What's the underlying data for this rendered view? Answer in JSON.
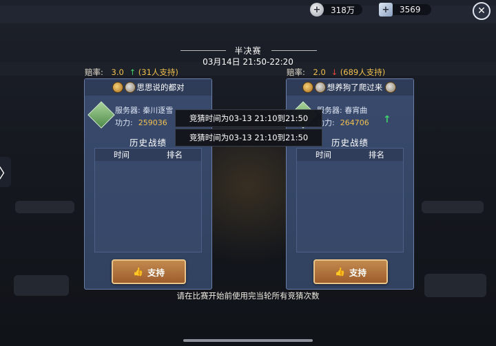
{
  "top_bar": {
    "silver": {
      "icon": "silver-coin-plus-icon",
      "value": "318万"
    },
    "ticket": {
      "icon": "ticket-plus-icon",
      "value": "3569"
    },
    "close": {
      "icon": "close-icon",
      "label": "✕"
    }
  },
  "side_toggle": {
    "icon": "chevron-right-icon",
    "label": "〉"
  },
  "match": {
    "stage": "半决赛",
    "time": "03月14日 21:50-22:20"
  },
  "left": {
    "odds_label": "赔率:",
    "odds_value": "3.0",
    "trend": "↑",
    "supporters": "(31人支持)",
    "player_name": "思思说的都对",
    "server_label": "服务器: 秦川逐雪",
    "power_label": "功力:",
    "power_value": "259036",
    "history_title": "历史战绩",
    "col_time": "时间",
    "col_rank": "排名",
    "support_button": "支持"
  },
  "right": {
    "odds_label": "赔率:",
    "odds_value": "2.0",
    "trend": "↓",
    "supporters": "(689人支持)",
    "player_name": "想养狗了爬过来",
    "server_label": "服务器: 春宵曲",
    "power_label": "功力:",
    "power_value": "264706",
    "power_trend": "↑",
    "history_title": "历史战绩",
    "col_time": "时间",
    "col_rank": "排名",
    "support_button": "支持"
  },
  "tooltips": [
    "竞猜时间为03-13 21:10到21:50",
    "竞猜时间为03-13 21:10到21:50"
  ],
  "footer": "请在比赛开始前使用完当轮所有竞猜次数",
  "colors": {
    "accent_gold": "#f2c14e",
    "up_green": "#3fd36b",
    "down_red": "#e64a3c",
    "panel_blue": "#394a6d",
    "button_bronze": "#b0743f"
  }
}
